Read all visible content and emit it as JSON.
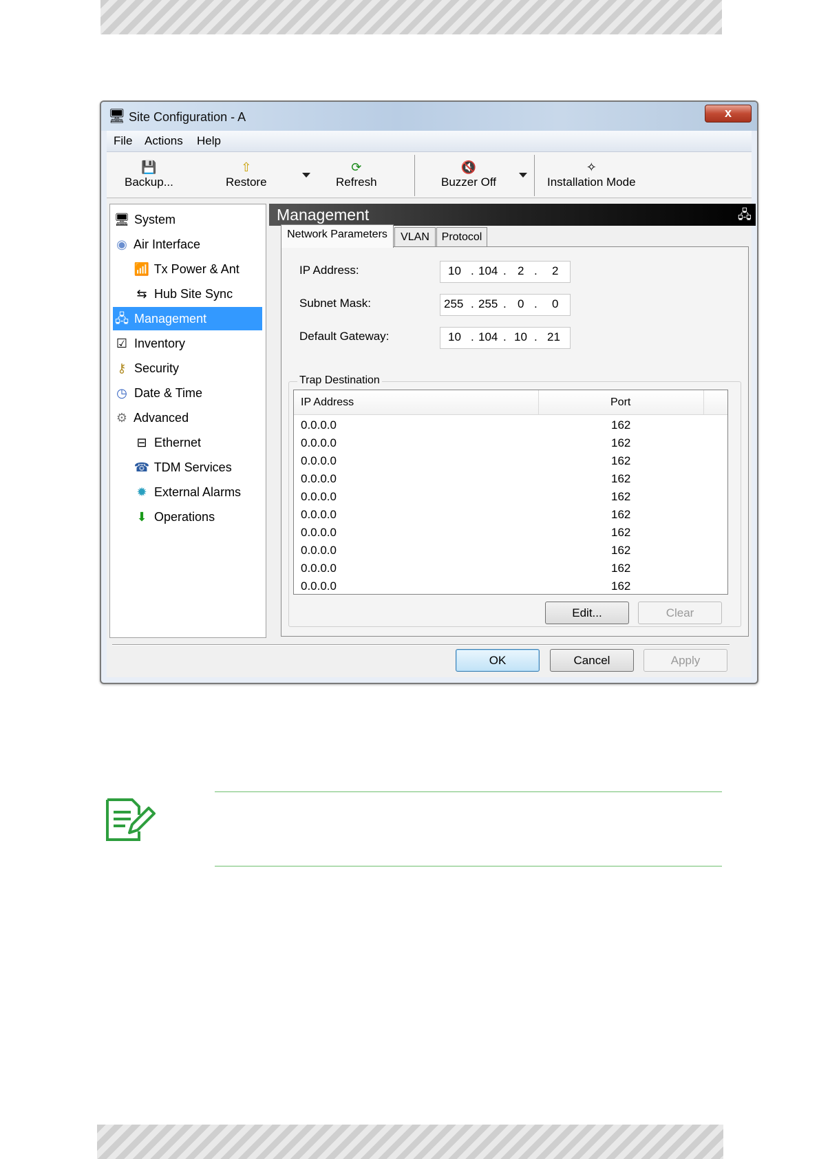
{
  "window": {
    "title": "Site Configuration - A",
    "close_glyph": "x"
  },
  "menu": [
    "File",
    "Actions",
    "Help"
  ],
  "toolbar": {
    "backup": "Backup...",
    "restore": "Restore",
    "refresh": "Refresh",
    "buzzer_off": "Buzzer Off",
    "installation_mode": "Installation Mode"
  },
  "tree": [
    {
      "label": "System",
      "icon": "system-icon"
    },
    {
      "label": "Air Interface",
      "icon": "air-interface-icon"
    },
    {
      "label": "Tx Power & Ant",
      "icon": "antenna-icon"
    },
    {
      "label": "Hub Site Sync",
      "icon": "sync-icon"
    },
    {
      "label": "Management",
      "icon": "management-icon",
      "selected": true
    },
    {
      "label": "Inventory",
      "icon": "inventory-icon"
    },
    {
      "label": "Security",
      "icon": "keys-icon"
    },
    {
      "label": "Date & Time",
      "icon": "clock-icon"
    },
    {
      "label": "Advanced",
      "icon": "gear-icon"
    },
    {
      "label": "Ethernet",
      "icon": "ethernet-icon"
    },
    {
      "label": "TDM Services",
      "icon": "tdm-icon"
    },
    {
      "label": "External Alarms",
      "icon": "alarm-icon"
    },
    {
      "label": "Operations",
      "icon": "arrow-down-icon"
    }
  ],
  "panel": {
    "title": "Management",
    "tabs": [
      "Network Parameters",
      "VLAN",
      "Protocol"
    ],
    "ip_label": "IP Address:",
    "ip_octets": [
      "10",
      "104",
      "2",
      "2"
    ],
    "subnet_label": "Subnet Mask:",
    "subnet_octets": [
      "255",
      "255",
      "0",
      "0"
    ],
    "gateway_label": "Default Gateway:",
    "gateway_octets": [
      "10",
      "104",
      "10",
      "21"
    ],
    "octet_sep": "."
  },
  "trap": {
    "legend": "Trap Destination",
    "columns": [
      "IP Address",
      "Port"
    ],
    "rows": [
      [
        "0.0.0.0",
        "162"
      ],
      [
        "0.0.0.0",
        "162"
      ],
      [
        "0.0.0.0",
        "162"
      ],
      [
        "0.0.0.0",
        "162"
      ],
      [
        "0.0.0.0",
        "162"
      ],
      [
        "0.0.0.0",
        "162"
      ],
      [
        "0.0.0.0",
        "162"
      ],
      [
        "0.0.0.0",
        "162"
      ],
      [
        "0.0.0.0",
        "162"
      ],
      [
        "0.0.0.0",
        "162"
      ]
    ],
    "edit": "Edit...",
    "clear": "Clear"
  },
  "buttons": {
    "ok": "OK",
    "cancel": "Cancel",
    "apply": "Apply"
  },
  "colors": {
    "selection": "#3399ff",
    "note_accent": "#2e9e3e"
  }
}
